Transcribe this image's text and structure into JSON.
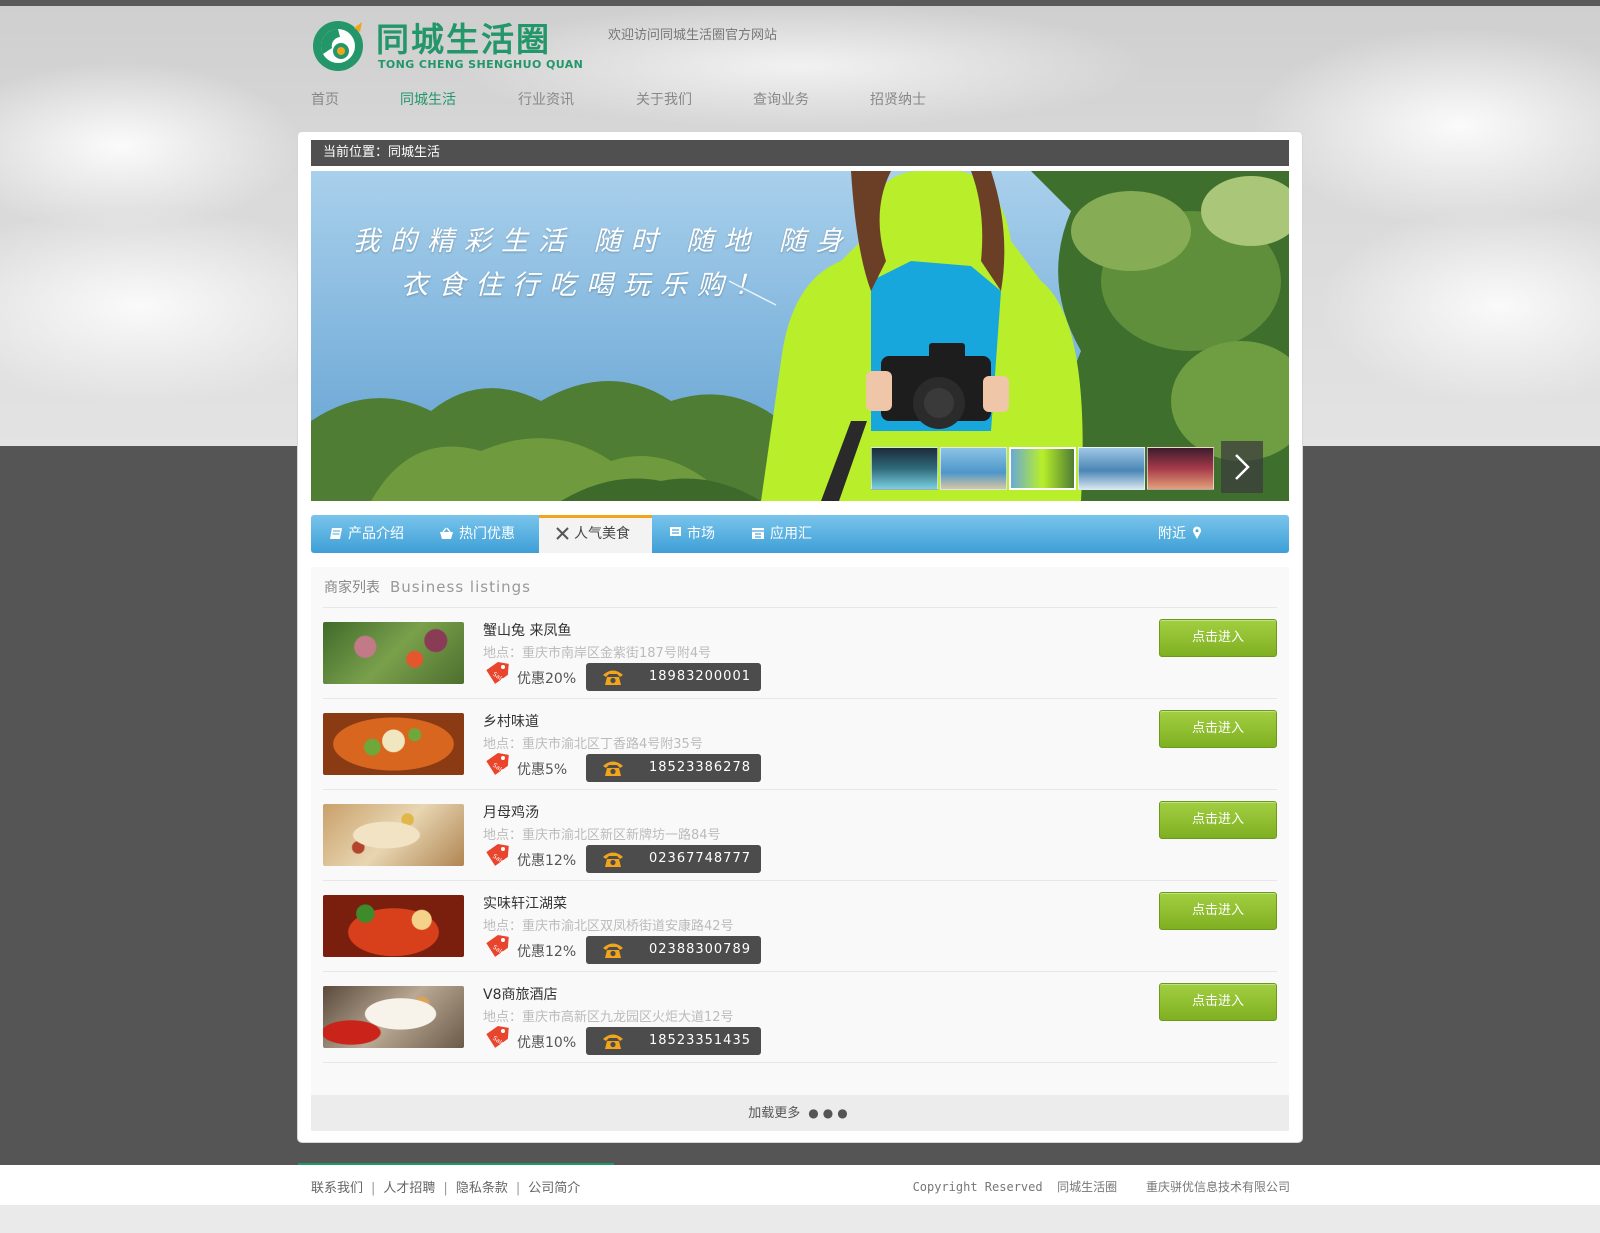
{
  "site": {
    "logo_cn": "同城生活圈",
    "logo_en": "TONG CHENG SHENGHUO QUAN",
    "welcome": "欢迎访问同城生活圈官方网站",
    "brand_color": "#23966a"
  },
  "nav": [
    {
      "label": "首页",
      "active": false
    },
    {
      "label": "同城生活",
      "active": true
    },
    {
      "label": "行业资讯",
      "active": false
    },
    {
      "label": "关于我们",
      "active": false
    },
    {
      "label": "查询业务",
      "active": false
    },
    {
      "label": "招贤纳士",
      "active": false
    }
  ],
  "breadcrumb": "当前位置：同城生活",
  "banner": {
    "line1": "我的精彩生活 随时 随地 随身",
    "line2": "衣食住行吃喝玩乐购！",
    "thumbnails": 5,
    "active_thumbnail": 3,
    "next_icon": "chevron-right-icon"
  },
  "tabs": [
    {
      "label": "产品介绍",
      "icon": "book-icon",
      "active": false
    },
    {
      "label": "热门优惠",
      "icon": "basket-icon",
      "active": false
    },
    {
      "label": "人气美食",
      "icon": "utensils-icon",
      "active": true
    },
    {
      "label": "市场",
      "icon": "market-icon",
      "active": false
    },
    {
      "label": "应用汇",
      "icon": "calendar-icon",
      "active": false
    },
    {
      "label": "附近",
      "icon": "location-pin-icon",
      "active": false
    }
  ],
  "listings": {
    "title_cn": "商家列表",
    "title_en": "Business listings",
    "enter_label": "点击进入",
    "items": [
      {
        "name": "蟹山兔 来凤鱼",
        "address": "地点：重庆市南岸区金紫街187号附4号",
        "discount": "优惠20%",
        "phone": "18983200001"
      },
      {
        "name": "乡村味道",
        "address": "地点：重庆市渝北区丁香路4号附35号",
        "discount": "优惠5%",
        "phone": "18523386278"
      },
      {
        "name": "月母鸡汤",
        "address": "地点：重庆市渝北区新区新牌坊一路84号",
        "discount": "优惠12%",
        "phone": "02367748777"
      },
      {
        "name": "实味轩江湖菜",
        "address": "地点：重庆市渝北区双凤桥街道安康路42号",
        "discount": "优惠12%",
        "phone": "02388300789"
      },
      {
        "name": "V8商旅酒店",
        "address": "地点：重庆市高新区九龙园区火炬大道12号",
        "discount": "优惠10%",
        "phone": "18523351435"
      }
    ],
    "load_more": "加载更多"
  },
  "footer": {
    "links": [
      "联系我们",
      "人才招聘",
      "隐私条款",
      "公司简介"
    ],
    "copyright_en": "Copyright Reserved",
    "copyright_site": "同城生活圈",
    "company": "重庆骈优信息技术有限公司"
  }
}
